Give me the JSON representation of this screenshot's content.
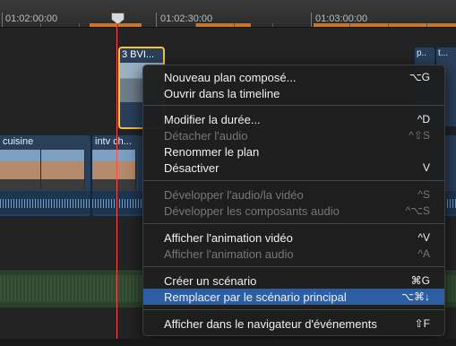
{
  "ruler": {
    "labels": [
      "01:02:00:00",
      "01:02:30:00",
      "01:03:00:00"
    ]
  },
  "clips": {
    "selected_title": "3 BVI...",
    "cuisine_title": "cuisine",
    "intv_title": "intv ch...",
    "right_titles": [
      "p..",
      "t..."
    ]
  },
  "context_menu": {
    "items": [
      {
        "label": "Nouveau plan composé...",
        "shortcut": "⌥G",
        "enabled": true
      },
      {
        "label": "Ouvrir dans la timeline",
        "shortcut": "",
        "enabled": true
      },
      {
        "label": "Modifier la durée...",
        "shortcut": "^D",
        "enabled": true
      },
      {
        "label": "Détacher l'audio",
        "shortcut": "^⇧S",
        "enabled": false
      },
      {
        "label": "Renommer le plan",
        "shortcut": "",
        "enabled": true
      },
      {
        "label": "Désactiver",
        "shortcut": "V",
        "enabled": true
      },
      {
        "label": "Développer l'audio/la vidéo",
        "shortcut": "^S",
        "enabled": false
      },
      {
        "label": "Développer les composants audio",
        "shortcut": "^⌥S",
        "enabled": false
      },
      {
        "label": "Afficher l'animation vidéo",
        "shortcut": "^V",
        "enabled": true
      },
      {
        "label": "Afficher l'animation audio",
        "shortcut": "^A",
        "enabled": false
      },
      {
        "label": "Créer un scénario",
        "shortcut": "⌘G",
        "enabled": true
      },
      {
        "label": "Remplacer par le scénario principal",
        "shortcut": "⌥⌘↓",
        "enabled": true,
        "highlighted": true
      },
      {
        "label": "Afficher dans le navigateur d'événements",
        "shortcut": "⇧F",
        "enabled": true
      }
    ]
  },
  "colors": {
    "playhead": "#ff4a4a",
    "selection": "#f3c53a",
    "menu_highlight": "#2d5ea1"
  }
}
